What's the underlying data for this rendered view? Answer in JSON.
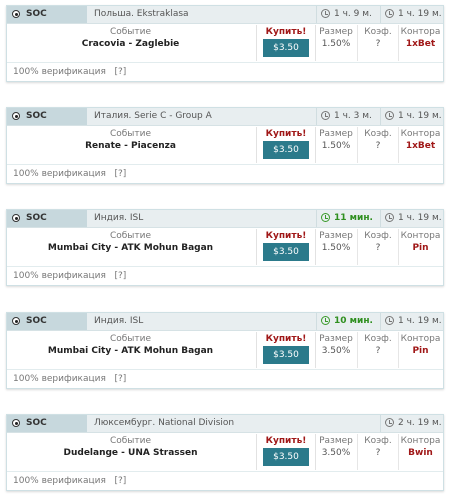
{
  "labels": {
    "event": "Событие",
    "buy": "Купить!",
    "size": "Размер",
    "coef": "Коэф.",
    "bookmaker": "Контора",
    "verification": "100% верификация",
    "help": "[?]"
  },
  "colors": {
    "accent": "#2b7a8b",
    "buy": "#a01818",
    "green_time": "#2f8f1f",
    "header_bg": "#e8eef0"
  },
  "cards": [
    {
      "sport": "SOC",
      "league": "Польша. Ekstraklasa",
      "time1": "1 ч. 9 м.",
      "time1_green": false,
      "time2": "1 ч. 19 м.",
      "event": "Cracovia - Zaglebie",
      "price": "$3.50",
      "size": "1.50%",
      "coef": "?",
      "bookmaker": "1xBet"
    },
    {
      "sport": "SOC",
      "league": "Италия. Serie C - Group A",
      "time1": "1 ч. 3 м.",
      "time1_green": false,
      "time2": "1 ч. 19 м.",
      "event": "Renate - Piacenza",
      "price": "$3.50",
      "size": "1.50%",
      "coef": "?",
      "bookmaker": "1xBet"
    },
    {
      "sport": "SOC",
      "league": "Индия. ISL",
      "time1": "11 мин.",
      "time1_green": true,
      "time2": "1 ч. 19 м.",
      "event": "Mumbai City - ATK Mohun Bagan",
      "price": "$3.50",
      "size": "1.50%",
      "coef": "?",
      "bookmaker": "Pin"
    },
    {
      "sport": "SOC",
      "league": "Индия. ISL",
      "time1": "10 мин.",
      "time1_green": true,
      "time2": "1 ч. 19 м.",
      "event": "Mumbai City - ATK Mohun Bagan",
      "price": "$3.50",
      "size": "3.50%",
      "coef": "?",
      "bookmaker": "Pin"
    },
    {
      "sport": "SOC",
      "league": "Люксембург. National Division",
      "time1": "",
      "time1_green": false,
      "time2": "2 ч. 19 м.",
      "event": "Dudelange - UNA Strassen",
      "price": "$3.50",
      "size": "3.50%",
      "coef": "?",
      "bookmaker": "Bwin"
    }
  ]
}
